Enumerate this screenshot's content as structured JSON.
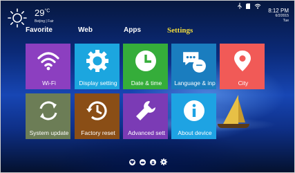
{
  "weather": {
    "temperature": "29",
    "unit": "°C",
    "location": "Beijing | Fair",
    "icon": "sun-icon"
  },
  "status": {
    "time": "8:12",
    "ampm": "PM",
    "date": "6/2/2015",
    "weekday": "Tue",
    "icons": [
      "usb-icon",
      "sd-card-icon",
      "wifi-icon"
    ]
  },
  "tabs": [
    {
      "label": "Favorite",
      "active": false
    },
    {
      "label": "Web",
      "active": false
    },
    {
      "label": "Apps",
      "active": false
    },
    {
      "label": "Settings",
      "active": true
    }
  ],
  "tiles": [
    {
      "label": "Wi-Fi",
      "icon": "wifi-icon",
      "color": "#8c3fc0"
    },
    {
      "label": "Display setting",
      "icon": "brightness-gear-icon",
      "color": "#1ca6df"
    },
    {
      "label": "Date & time",
      "icon": "clock-icon",
      "color": "#35ad3a"
    },
    {
      "label": "Language & inp",
      "icon": "chat-bubbles-icon",
      "color": "#1a7dbf"
    },
    {
      "label": "City",
      "icon": "location-pin-icon",
      "color": "#f15a57"
    },
    {
      "label": "System update",
      "icon": "sync-icon",
      "color": "#6c7d56"
    },
    {
      "label": "Factory reset",
      "icon": "history-clock-icon",
      "color": "#8a4e16"
    },
    {
      "label": "Advanced sett",
      "icon": "wrench-icon",
      "color": "#7b3bb5"
    },
    {
      "label": "About device",
      "icon": "info-icon",
      "color": "#1ea3e3"
    }
  ],
  "dock": [
    "heart-icon",
    "gamepad-icon",
    "android-icon",
    "gear-icon"
  ]
}
